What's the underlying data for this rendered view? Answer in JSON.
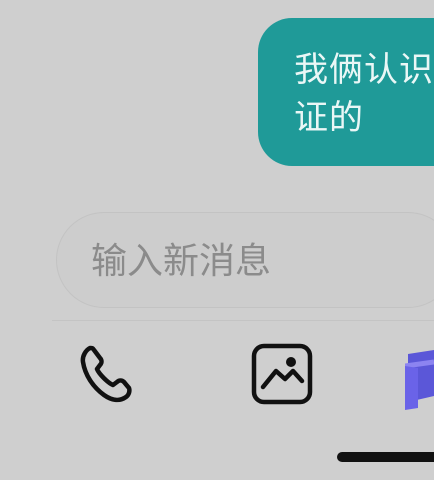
{
  "chat": {
    "bubble_lines": [
      "我俩认识",
      "证的"
    ]
  },
  "composer": {
    "placeholder": "输入新消息"
  },
  "toolbar": {
    "items": [
      {
        "icon": "phone-icon"
      },
      {
        "icon": "image-icon"
      },
      {
        "icon": "gift-box-icon"
      }
    ]
  },
  "colors": {
    "background": "#cfcfcf",
    "bubble": "#1f9a98",
    "accent_purple": "#5a4fd6"
  }
}
